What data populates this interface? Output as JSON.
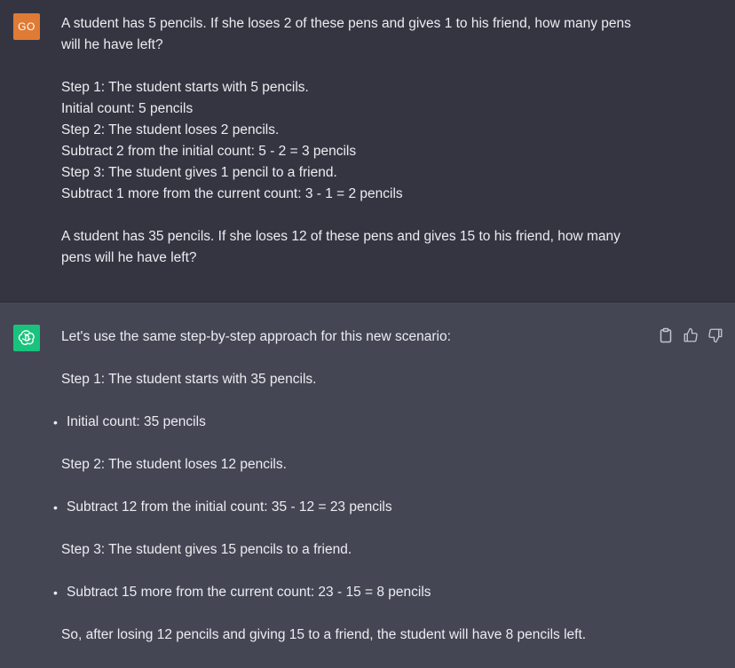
{
  "user": {
    "avatar_initials": "GO",
    "avatar_color": "#df7b35",
    "lines": [
      "A student has 5 pencils. If she loses 2 of these pens and gives 1 to his friend, how many pens",
      "will he have left?",
      "",
      "Step 1: The student starts with 5 pencils.",
      "Initial count: 5 pencils",
      "Step 2: The student loses 2 pencils.",
      "Subtract 2 from the initial count: 5 - 2 = 3 pencils",
      "Step 3: The student gives 1 pencil to a friend.",
      "Subtract 1 more from the current count: 3 - 1 = 2 pencils",
      "",
      "A student has 35 pencils. If she loses 12 of these pens and gives 15 to his friend, how many",
      "pens will he have left?"
    ]
  },
  "assistant": {
    "avatar_color": "#19c37d",
    "intro": "Let's use the same step-by-step approach for this new scenario:",
    "step1": "Step 1: The student starts with 35 pencils.",
    "bullet1": "Initial count: 35 pencils",
    "step2": "Step 2: The student loses 12 pencils.",
    "bullet2": "Subtract 12 from the initial count: 35 - 12 = 23 pencils",
    "step3": "Step 3: The student gives 15 pencils to a friend.",
    "bullet3": "Subtract 15 more from the current count: 23 - 15 = 8 pencils",
    "conclusion": "So, after losing 12 pencils and giving 15 to a friend, the student will have 8 pencils left.",
    "bullet_glyph": "•"
  },
  "actions": {
    "icons": [
      "clipboard-icon",
      "thumbs-up-icon",
      "thumbs-down-icon"
    ]
  }
}
